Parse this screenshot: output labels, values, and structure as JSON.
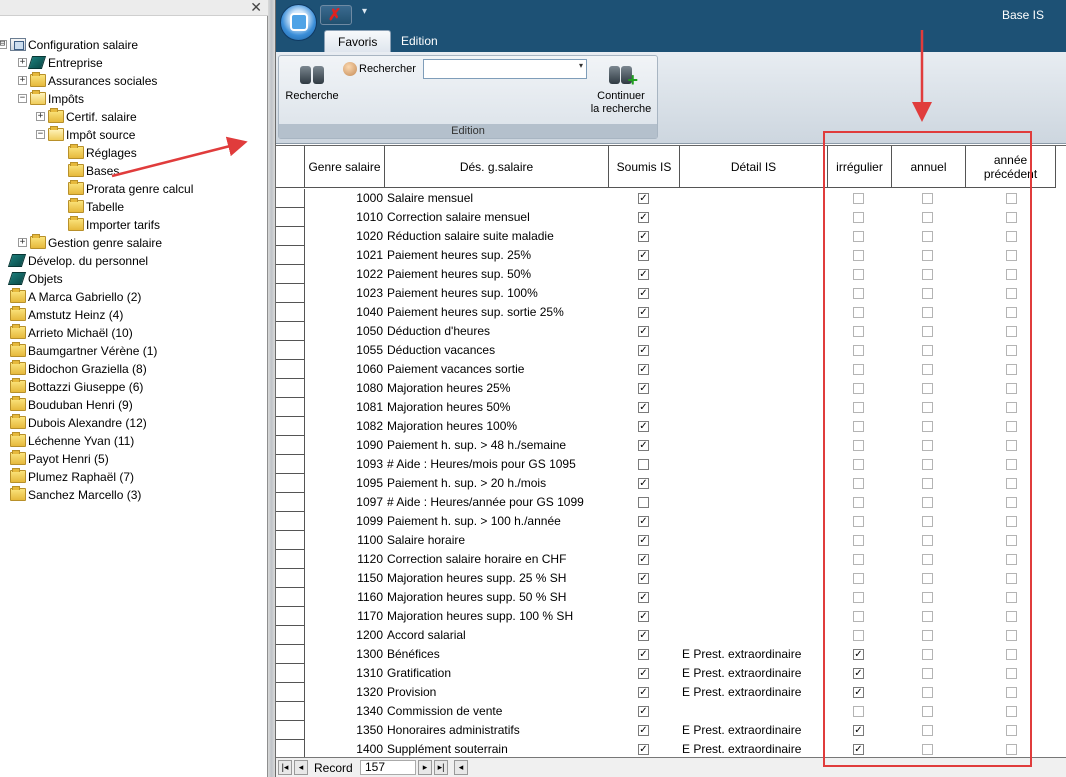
{
  "tree": {
    "close_glyph": "✕",
    "nodes": [
      {
        "label": "Configuration salaire",
        "level": 0,
        "icon": "config-icon",
        "expander": "⊟"
      },
      {
        "label": "Entreprise",
        "level": 1,
        "icon": "book-icon",
        "expander": "+"
      },
      {
        "label": "Assurances sociales",
        "level": 1,
        "icon": "folder-icon",
        "expander": "+"
      },
      {
        "label": "Impôts",
        "level": 1,
        "icon": "folder-open-icon",
        "expander": "−"
      },
      {
        "label": "Certif. salaire",
        "level": 2,
        "icon": "folder-icon",
        "expander": "+"
      },
      {
        "label": "Impôt source",
        "level": 2,
        "icon": "folder-open-icon",
        "expander": "−"
      },
      {
        "label": "Réglages",
        "level": 3,
        "icon": "folder-icon",
        "expander": ""
      },
      {
        "label": "Bases",
        "level": 3,
        "icon": "folder-icon",
        "expander": ""
      },
      {
        "label": "Prorata genre calcul",
        "level": 3,
        "icon": "folder-icon",
        "expander": ""
      },
      {
        "label": "Tabelle",
        "level": 3,
        "icon": "folder-icon",
        "expander": ""
      },
      {
        "label": "Importer tarifs",
        "level": 3,
        "icon": "folder-icon",
        "expander": ""
      },
      {
        "label": "Gestion genre salaire",
        "level": 1,
        "icon": "folder-icon",
        "expander": "+"
      },
      {
        "label": "Dévelop. du personnel",
        "level": 0,
        "icon": "book-icon",
        "expander": ""
      },
      {
        "label": "Objets",
        "level": 0,
        "icon": "book-icon",
        "expander": ""
      },
      {
        "label": "A Marca Gabriello (2)",
        "level": 0,
        "icon": "folder-icon",
        "expander": ""
      },
      {
        "label": "Amstutz Heinz (4)",
        "level": 0,
        "icon": "folder-icon",
        "expander": ""
      },
      {
        "label": "Arrieto Michaël (10)",
        "level": 0,
        "icon": "folder-icon",
        "expander": ""
      },
      {
        "label": "Baumgartner Vérène (1)",
        "level": 0,
        "icon": "folder-icon",
        "expander": ""
      },
      {
        "label": "Bidochon Graziella (8)",
        "level": 0,
        "icon": "folder-icon",
        "expander": ""
      },
      {
        "label": "Bottazzi Giuseppe (6)",
        "level": 0,
        "icon": "folder-icon",
        "expander": ""
      },
      {
        "label": "Bouduban Henri (9)",
        "level": 0,
        "icon": "folder-icon",
        "expander": ""
      },
      {
        "label": "Dubois Alexandre (12)",
        "level": 0,
        "icon": "folder-icon",
        "expander": ""
      },
      {
        "label": "Léchenne Yvan (11)",
        "level": 0,
        "icon": "folder-icon",
        "expander": ""
      },
      {
        "label": "Payot Henri (5)",
        "level": 0,
        "icon": "folder-icon",
        "expander": ""
      },
      {
        "label": "Plumez Raphaël (7)",
        "level": 0,
        "icon": "folder-icon",
        "expander": ""
      },
      {
        "label": "Sanchez Marcello (3)",
        "level": 0,
        "icon": "folder-icon",
        "expander": ""
      }
    ]
  },
  "app": {
    "title": "Base IS",
    "qat_close_glyph": "✗",
    "qat_dropdown_glyph": "▾"
  },
  "tabs": [
    {
      "label": "Favoris",
      "active": true
    },
    {
      "label": "Edition",
      "active": false
    }
  ],
  "ribbon": {
    "search_button": "Recherche",
    "rechercher_label": "Rechercher",
    "rechercher_value": "",
    "combo_arrow": "▾",
    "continue_line1": "Continuer",
    "continue_line2": "la recherche",
    "group_label": "Edition"
  },
  "grid": {
    "headers": {
      "genre": "Genre salaire",
      "desc": "Dés. g.salaire",
      "soumis": "Soumis IS",
      "detail": "Détail IS",
      "irregulier": "irrégulier",
      "annuel": "annuel",
      "annee_precedent": "année précédent"
    },
    "check_glyph": "✓",
    "rows": [
      {
        "code": "1000",
        "desc": "Salaire mensuel",
        "soumis": true,
        "detail": "",
        "irr": false,
        "ann": false,
        "prev": false
      },
      {
        "code": "1010",
        "desc": "Correction salaire mensuel",
        "soumis": true,
        "detail": "",
        "irr": false,
        "ann": false,
        "prev": false
      },
      {
        "code": "1020",
        "desc": "Réduction salaire suite maladie",
        "soumis": true,
        "detail": "",
        "irr": false,
        "ann": false,
        "prev": false
      },
      {
        "code": "1021",
        "desc": "Paiement heures sup.  25%",
        "soumis": true,
        "detail": "",
        "irr": false,
        "ann": false,
        "prev": false
      },
      {
        "code": "1022",
        "desc": "Paiement heures sup.  50%",
        "soumis": true,
        "detail": "",
        "irr": false,
        "ann": false,
        "prev": false
      },
      {
        "code": "1023",
        "desc": "Paiement heures sup. 100%",
        "soumis": true,
        "detail": "",
        "irr": false,
        "ann": false,
        "prev": false
      },
      {
        "code": "1040",
        "desc": "Paiement heures sup. sortie 25%",
        "soumis": true,
        "detail": "",
        "irr": false,
        "ann": false,
        "prev": false
      },
      {
        "code": "1050",
        "desc": "Déduction d'heures",
        "soumis": true,
        "detail": "",
        "irr": false,
        "ann": false,
        "prev": false
      },
      {
        "code": "1055",
        "desc": "Déduction vacances",
        "soumis": true,
        "detail": "",
        "irr": false,
        "ann": false,
        "prev": false
      },
      {
        "code": "1060",
        "desc": "Paiement vacances sortie",
        "soumis": true,
        "detail": "",
        "irr": false,
        "ann": false,
        "prev": false
      },
      {
        "code": "1080",
        "desc": "Majoration heures 25%",
        "soumis": true,
        "detail": "",
        "irr": false,
        "ann": false,
        "prev": false
      },
      {
        "code": "1081",
        "desc": "Majoration heures 50%",
        "soumis": true,
        "detail": "",
        "irr": false,
        "ann": false,
        "prev": false
      },
      {
        "code": "1082",
        "desc": "Majoration heures 100%",
        "soumis": true,
        "detail": "",
        "irr": false,
        "ann": false,
        "prev": false
      },
      {
        "code": "1090",
        "desc": "Paiement  h. sup. > 48 h./semaine",
        "soumis": true,
        "detail": "",
        "irr": false,
        "ann": false,
        "prev": false
      },
      {
        "code": "1093",
        "desc": "# Aide : Heures/mois pour GS 1095",
        "soumis": false,
        "detail": "",
        "irr": false,
        "ann": false,
        "prev": false
      },
      {
        "code": "1095",
        "desc": "Paiement h. sup. > 20 h./mois",
        "soumis": true,
        "detail": "",
        "irr": false,
        "ann": false,
        "prev": false
      },
      {
        "code": "1097",
        "desc": "# Aide : Heures/année pour GS 1099",
        "soumis": false,
        "detail": "",
        "irr": false,
        "ann": false,
        "prev": false
      },
      {
        "code": "1099",
        "desc": "Paiement h. sup. > 100 h./année",
        "soumis": true,
        "detail": "",
        "irr": false,
        "ann": false,
        "prev": false
      },
      {
        "code": "1100",
        "desc": "Salaire horaire",
        "soumis": true,
        "detail": "",
        "irr": false,
        "ann": false,
        "prev": false
      },
      {
        "code": "1120",
        "desc": "Correction salaire horaire en CHF",
        "soumis": true,
        "detail": "",
        "irr": false,
        "ann": false,
        "prev": false
      },
      {
        "code": "1150",
        "desc": "Majoration heures supp. 25 % SH",
        "soumis": true,
        "detail": "",
        "irr": false,
        "ann": false,
        "prev": false
      },
      {
        "code": "1160",
        "desc": "Majoration heures supp. 50 % SH",
        "soumis": true,
        "detail": "",
        "irr": false,
        "ann": false,
        "prev": false
      },
      {
        "code": "1170",
        "desc": "Majoration heures supp. 100 % SH",
        "soumis": true,
        "detail": "",
        "irr": false,
        "ann": false,
        "prev": false
      },
      {
        "code": "1200",
        "desc": "Accord salarial",
        "soumis": true,
        "detail": "",
        "irr": false,
        "ann": false,
        "prev": false
      },
      {
        "code": "1300",
        "desc": "Bénéfices",
        "soumis": true,
        "detail": "E Prest. extraordinaire",
        "irr": true,
        "ann": false,
        "prev": false
      },
      {
        "code": "1310",
        "desc": "Gratification",
        "soumis": true,
        "detail": "E Prest. extraordinaire",
        "irr": true,
        "ann": false,
        "prev": false
      },
      {
        "code": "1320",
        "desc": "Provision",
        "soumis": true,
        "detail": "E Prest. extraordinaire",
        "irr": true,
        "ann": false,
        "prev": false
      },
      {
        "code": "1340",
        "desc": "Commission de vente",
        "soumis": true,
        "detail": "",
        "irr": false,
        "ann": false,
        "prev": false
      },
      {
        "code": "1350",
        "desc": "Honoraires administratifs",
        "soumis": true,
        "detail": "E Prest. extraordinaire",
        "irr": true,
        "ann": false,
        "prev": false
      },
      {
        "code": "1400",
        "desc": "Supplément souterrain",
        "soumis": true,
        "detail": "E Prest. extraordinaire",
        "irr": true,
        "ann": false,
        "prev": false
      }
    ]
  },
  "record_bar": {
    "first_glyph": "|◂",
    "prev_glyph": "◂",
    "label": "Record",
    "value": "157",
    "next_glyph": "▸",
    "last_glyph": "▸|",
    "left_glyph": "◂"
  },
  "colors": {
    "titlebar": "#1d5175",
    "annotation": "#e03c3c"
  }
}
